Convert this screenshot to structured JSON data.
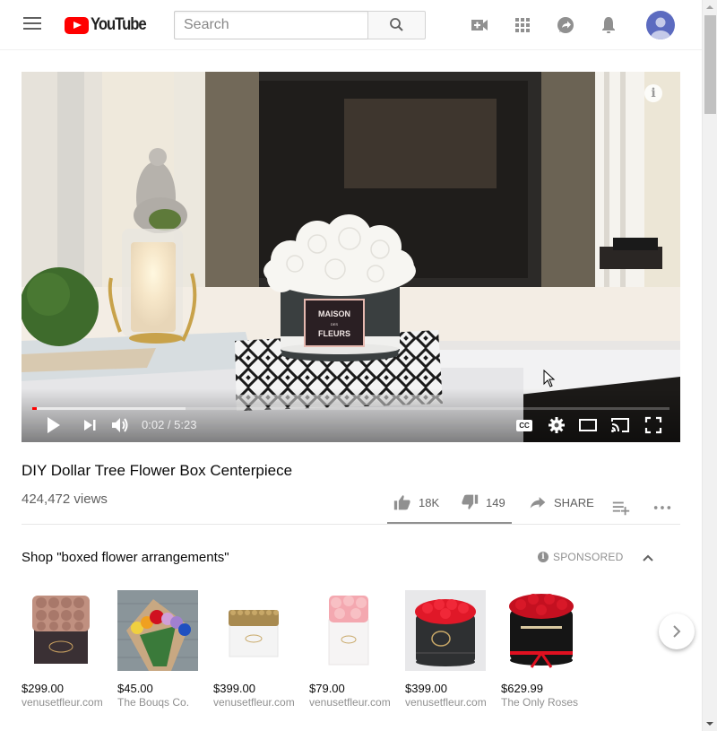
{
  "header": {
    "logo_text": "YouTube",
    "search_placeholder": "Search",
    "icons": [
      "menu-icon",
      "search-icon",
      "create-video-icon",
      "apps-icon",
      "messages-icon",
      "notifications-icon",
      "account-avatar"
    ]
  },
  "player": {
    "current_time": "0:02",
    "duration": "5:23",
    "time_display": "0:02 / 5:23",
    "progress_played_fraction": 0.006,
    "progress_buffered_fraction": 0.24,
    "overlay_brand_line1": "MAISON",
    "overlay_brand_line2": "FLEURS",
    "overlay_brand_small": "DES",
    "controls": [
      "play",
      "next",
      "volume",
      "captions",
      "settings",
      "theater-mode",
      "cast",
      "fullscreen"
    ],
    "cc_label": "CC"
  },
  "video": {
    "title": "DIY Dollar Tree Flower Box Centerpiece",
    "views": "424,472 views",
    "likes": "18K",
    "dislikes": "149",
    "share_label": "SHARE",
    "like_ratio": 0.992
  },
  "shop": {
    "title": "Shop \"boxed flower arrangements\"",
    "sponsored_label": "SPONSORED",
    "products": [
      {
        "price": "$299.00",
        "merchant": "venusetfleur.com",
        "image": "rose-gold-roses-black-box"
      },
      {
        "price": "$45.00",
        "merchant": "The Bouqs Co.",
        "image": "rainbow-rose-bouquet"
      },
      {
        "price": "$399.00",
        "merchant": "venusetfleur.com",
        "image": "gold-roses-white-box"
      },
      {
        "price": "$79.00",
        "merchant": "venusetfleur.com",
        "image": "pink-roses-white-box"
      },
      {
        "price": "$399.00",
        "merchant": "venusetfleur.com",
        "image": "red-roses-black-round-box"
      },
      {
        "price": "$629.99",
        "merchant": "The Only Roses",
        "image": "red-roses-black-box-ribbon"
      }
    ]
  },
  "colors": {
    "brand_red": "#ff0000",
    "text_primary": "#0a0a0a",
    "text_secondary": "#606060",
    "avatar_bg": "#5c6bc0"
  }
}
